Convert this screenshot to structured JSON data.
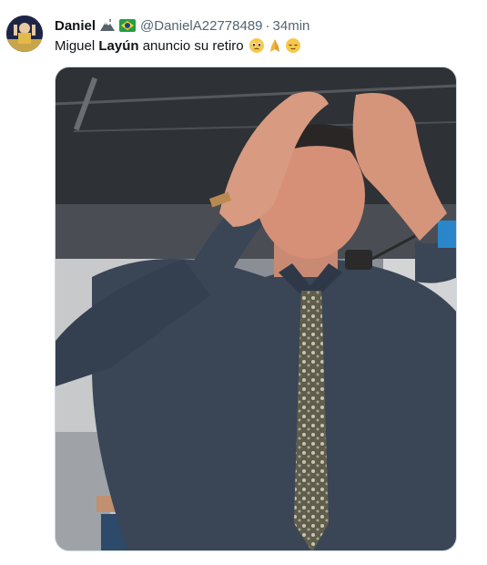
{
  "tweet": {
    "author_name": "Daniel",
    "author_handle": "@DanielA22778489",
    "separator": "·",
    "time": "34min",
    "text_before": "Miguel ",
    "text_bold": "Layún",
    "text_after": " anuncio su retiro",
    "emojis": [
      "pleading-face-icon",
      "folded-hands-icon",
      "relieved-face-icon"
    ],
    "badges": [
      "mountain-icon",
      "brazil-flag-icon"
    ]
  },
  "colors": {
    "name": "#0f1419",
    "secondary": "#536471",
    "media_border": "#cfd9de"
  }
}
